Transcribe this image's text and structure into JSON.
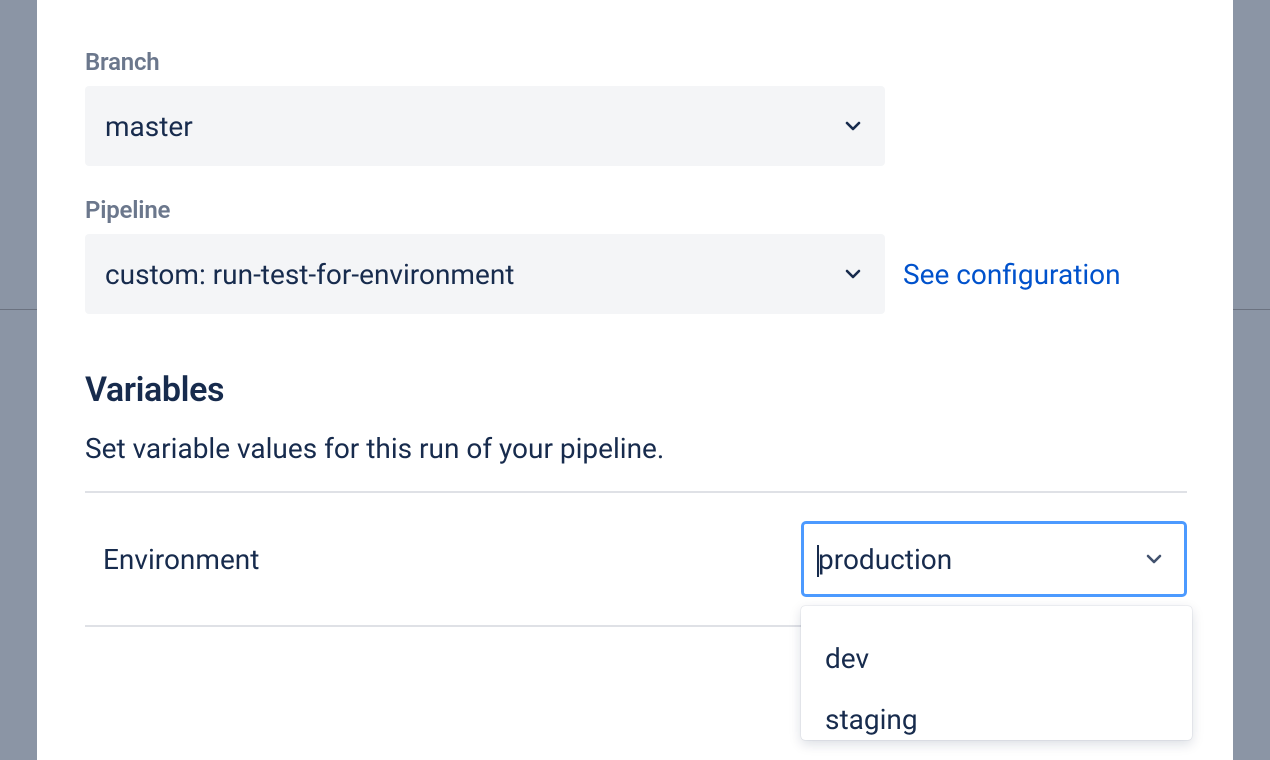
{
  "branch": {
    "label": "Branch",
    "value": "master"
  },
  "pipeline": {
    "label": "Pipeline",
    "value": "custom: run-test-for-environment",
    "config_link": "See configuration"
  },
  "variables": {
    "heading": "Variables",
    "description": "Set variable values for this run of your pipeline.",
    "rows": [
      {
        "name": "Environment",
        "value": "production",
        "options": [
          "dev",
          "staging"
        ]
      }
    ]
  }
}
